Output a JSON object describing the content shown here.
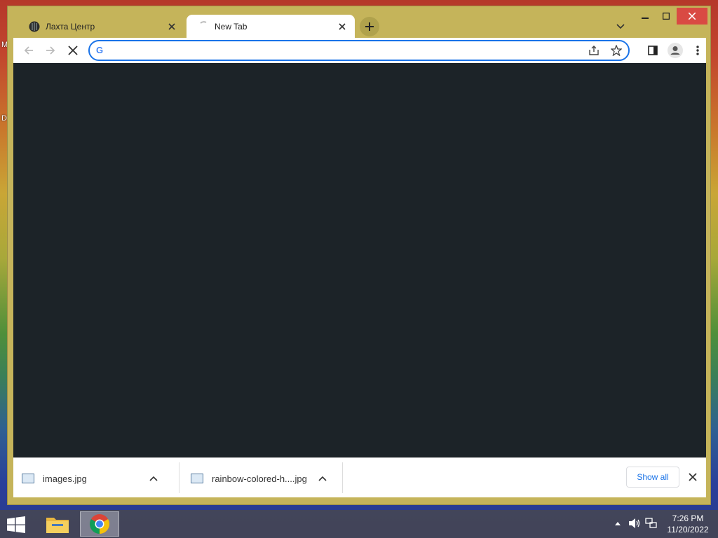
{
  "desktop": {
    "left_letters": [
      "M",
      "D"
    ]
  },
  "browser": {
    "tabs": [
      {
        "title": "Лахта Центр",
        "active": false
      },
      {
        "title": "New Tab",
        "active": true
      }
    ],
    "address_bar": {
      "value": "",
      "placeholder": ""
    },
    "downloads": [
      {
        "filename": "images.jpg"
      },
      {
        "filename": "rainbow-colored-h....jpg"
      }
    ],
    "show_all_label": "Show all"
  },
  "taskbar": {
    "time": "7:26 PM",
    "date": "11/20/2022"
  },
  "colors": {
    "window_frame": "#c5b45a",
    "content_bg": "#1c2328",
    "accent": "#1a73e8",
    "close_button": "#d94a43"
  }
}
